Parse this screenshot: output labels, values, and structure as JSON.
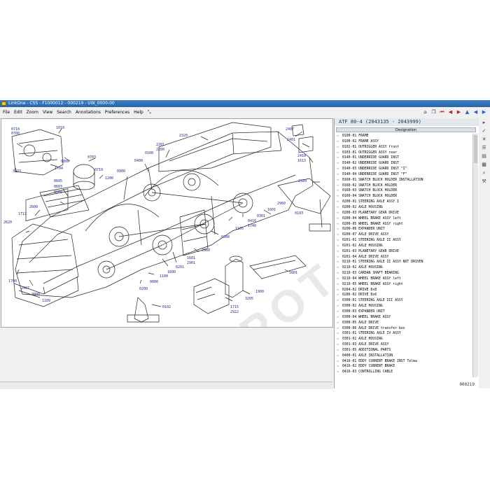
{
  "window": {
    "title": "LinkOne - CSS - F1000012 - 000219 - UW_0000-00"
  },
  "menu": [
    "File",
    "Edit",
    "Zoom",
    "View",
    "Search",
    "Annotations",
    "Preferences",
    "Help"
  ],
  "toolbar_icons": [
    "home-icon",
    "copy-icon",
    "go-first-icon",
    "go-previous-icon",
    "go-next-icon",
    "go-up-icon",
    "go-back-icon",
    "go-forward-icon"
  ],
  "parts": {
    "header": "ATF 80-4 (2043135 - 2043999)",
    "column": "Designation",
    "rows": [
      "0100-01 FRAME",
      "0100-02 FRAME ASSY",
      "0102-01 OUTRIGGER ASSY front",
      "0103-01 OUTRIGGER ASSY rear",
      "0140-01 UNDERRIDE GUARD INST",
      "0140-02 UNDERRIDE GUARD INST",
      "0140-03 UNDERRIDE GUARD INST \"I\"",
      "0140-04 UNDERRIDE GUARD INST \"F\"",
      "0160-01 SNATCH BLOCK HOLDER INSTALLATION",
      "0160-02 SNATCH BLOCK HOLDER",
      "0160-03 SNATCH BLOCK HOLDER",
      "0160-04 SNATCH BLOCK HOLDER",
      "0200-01 STEERING AXLE ASSY I",
      "0200-02 AXLE HOUSING",
      "0200-03 PLANETARY GEAR DRIVE",
      "0200-04 WHEEL BRAKE ASSY left",
      "0200-05 WHEEL BRAKE ASSY right",
      "0200-06 EXPANDER UNIT",
      "0200-07 AXLE DRIVE ASSY",
      "0201-01 STEERING AXLE II ASSY",
      "0201-02 AXLE HOUSING",
      "0201-03 PLANETARY GEAR DRIVE",
      "0201-04 AXLE DRIVE ASSY",
      "0210-01 STEERING AXLE II ASSY NOT DRIVEN",
      "0210-02 AXLE HOUSING",
      "0210-03 CARDAN SHAFT BEARING",
      "0210-04 WHEEL BRAKE ASSY left",
      "0210-05 WHEEL BRAKE ASSY right",
      "0284-02 DRIVE 8x8",
      "0286-02 DRIVE 8x6",
      "0300-01 STEERING AXLE III ASSY",
      "0300-02 AXLE HOUSING",
      "0300-03 EXPANDER UNIT",
      "0300-04 WHEEL BRAKE ASSY",
      "0300-05 AXLE DRIVE",
      "0300-06 AXLE DRIVE transfer box",
      "0301-01 STEERING AXLE IV ASSY",
      "0301-02 AXLE HOUSING",
      "0301-03 AXLE DRIVE ASSY",
      "0301-05 ADDITIONAL PARTS",
      "0400-01 AXLE INSTALLATION",
      "0416-01 EDDY CURRENT BRAKE INST Telma",
      "0416-02 EDDY CURRENT BRAKE",
      "0416-03 CONTROLLING CABLE"
    ],
    "page": "000219"
  },
  "drawing": {
    "callouts": [
      {
        "t": "0710"
      },
      {
        "t": "0700"
      },
      {
        "t": "1010"
      },
      {
        "t": "0800"
      },
      {
        "t": "1704"
      },
      {
        "t": "3233"
      },
      {
        "t": "0703"
      },
      {
        "t": "0719"
      },
      {
        "t": "0605"
      },
      {
        "t": "0603"
      },
      {
        "t": "0600"
      },
      {
        "t": "1200"
      },
      {
        "t": "0900"
      },
      {
        "t": "0400"
      },
      {
        "t": "0100"
      },
      {
        "t": "2201"
      },
      {
        "t": "2200"
      },
      {
        "t": "2320"
      },
      {
        "t": "2407"
      },
      {
        "t": "2401"
      },
      {
        "t": "2410"
      },
      {
        "t": "1613"
      },
      {
        "t": "2320"
      },
      {
        "t": "1601"
      },
      {
        "t": "2960"
      },
      {
        "t": "0103"
      },
      {
        "t": "0301"
      },
      {
        "t": "0416"
      },
      {
        "t": "1740"
      },
      {
        "t": "1105"
      },
      {
        "t": "0300"
      },
      {
        "t": "2960"
      },
      {
        "t": "1601"
      },
      {
        "t": "2901"
      },
      {
        "t": "0201"
      },
      {
        "t": "1600"
      },
      {
        "t": "1100"
      },
      {
        "t": "0800"
      },
      {
        "t": "0200"
      },
      {
        "t": "1713"
      },
      {
        "t": "2600"
      },
      {
        "t": "2620"
      },
      {
        "t": "1700"
      },
      {
        "t": "2407"
      },
      {
        "t": "3000"
      },
      {
        "t": "1109"
      },
      {
        "t": "0102"
      },
      {
        "t": "1715"
      },
      {
        "t": "2922"
      },
      {
        "t": "3205"
      },
      {
        "t": "1900"
      },
      {
        "t": "5801"
      }
    ],
    "watermark": "EPCDEPOT.COM"
  }
}
